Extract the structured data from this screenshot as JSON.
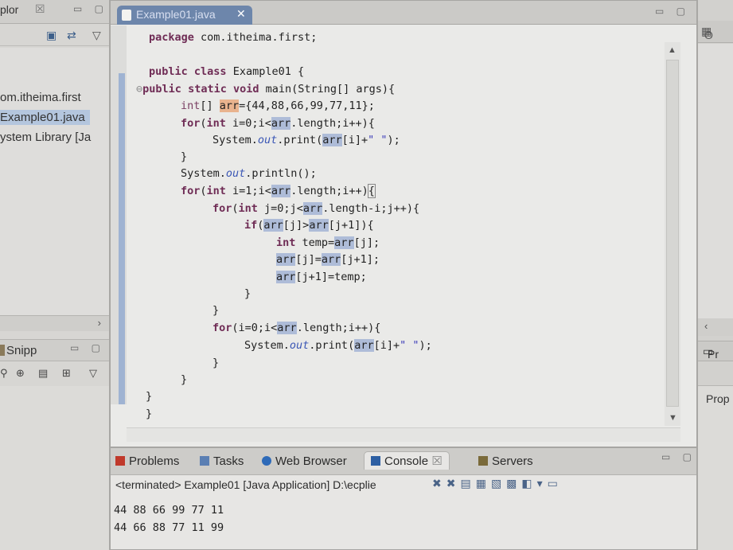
{
  "left": {
    "title": "plor",
    "close_glyph": "☒",
    "tree": [
      {
        "label": "om.itheima.first",
        "selected": false
      },
      {
        "label": "Example01.java",
        "selected": true
      },
      {
        "label": "ystem Library [Ja",
        "selected": false
      }
    ],
    "snippets_label": "Snipp"
  },
  "editor": {
    "tab_title": "Example01.java",
    "tab_close": "✕"
  },
  "console": {
    "tabs": [
      {
        "label": "Problems",
        "icon_color": "#c0392b"
      },
      {
        "label": "Tasks",
        "icon_color": "#5b7fb3"
      },
      {
        "label": "Web Browser",
        "icon_color": "#2e6ab8"
      },
      {
        "label": "Console",
        "icon_color": "#2d5fa3",
        "active": true,
        "close": "☒"
      },
      {
        "label": "Servers",
        "icon_color": "#7a6a3a"
      }
    ],
    "status": "<terminated> Example01 [Java Application] D:\\ecplie",
    "output": [
      "44 88 66 99 77 11",
      "44 66 88 77 11 99"
    ]
  },
  "right": {
    "outline_label": "O",
    "pr_label": "Pr",
    "prop_label": "Prop"
  }
}
